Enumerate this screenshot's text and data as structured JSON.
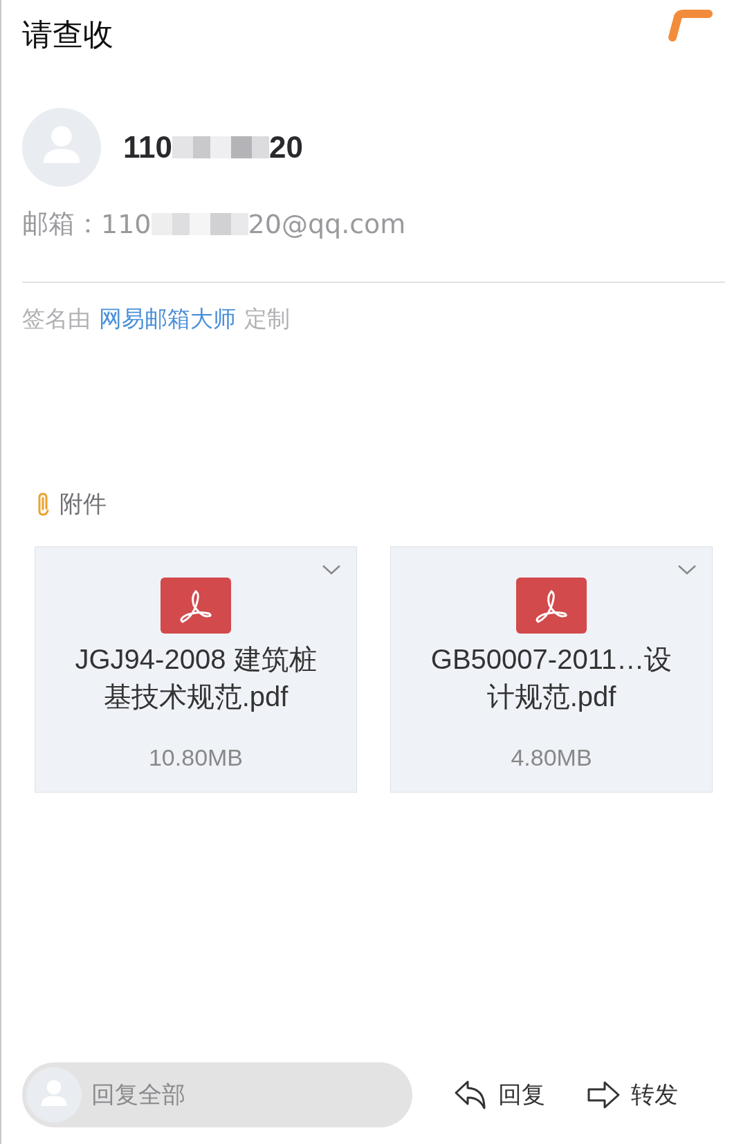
{
  "subject": "请查收",
  "sender": {
    "name_start": "110",
    "name_end": "20",
    "name_redacted": true
  },
  "email": {
    "label": "邮箱：",
    "address_start": "110",
    "address_end": "20@qq.com",
    "address_redacted": true
  },
  "signature": {
    "prefix": "签名由",
    "link": "网易邮箱大师",
    "suffix": "定制"
  },
  "attachments": {
    "label": "附件",
    "files": [
      {
        "kind": "pdf",
        "name": "JGJ94-2008 建筑桩基技术规范.pdf",
        "size": "10.80MB"
      },
      {
        "kind": "pdf",
        "name": "GB50007-2011…设计规范.pdf",
        "size": "4.80MB"
      }
    ]
  },
  "bottom_bar": {
    "reply_all_placeholder": "回复全部",
    "reply": "回复",
    "forward": "转发"
  }
}
